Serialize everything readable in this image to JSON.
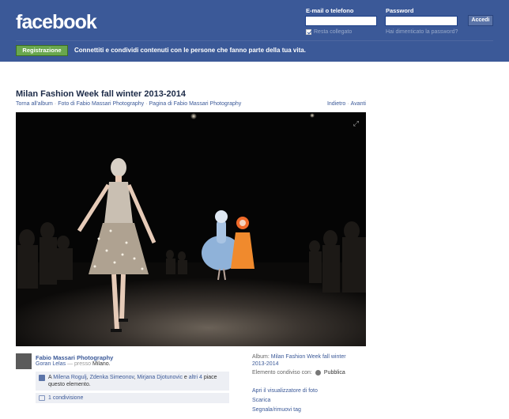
{
  "header": {
    "logo": "facebook",
    "email_label": "E-mail o telefono",
    "password_label": "Password",
    "login_button": "Accedi",
    "keep_logged_in": "Resta collegato",
    "forgot_password": "Hai dimenticato la password?",
    "register_button": "Registrazione",
    "tagline": "Connettiti e condividi contenuti con le persone che fanno parte della tua vita."
  },
  "album": {
    "title": "Milan Fashion Week fall winter 2013-2014",
    "crumbs": [
      "Torna all'album",
      "Foto di Fabio Massari Photography",
      "Pagina di Fabio Massari Photography"
    ],
    "prev": "Indietro",
    "next": "Avanti"
  },
  "post": {
    "owner": "Fabio Massari Photography",
    "tagged": "Goran Lelas",
    "with_sep": "— presso",
    "location": "Milano.",
    "likes_text_pre": "A",
    "likers": [
      "Milena Rogulj",
      "Zdenka Simeonov",
      "Mirjana Djotunovic"
    ],
    "likes_and": "e",
    "likes_others": "altri 4",
    "likes_suffix_1": "piace",
    "likes_suffix_2": "questo elemento.",
    "shares": "1 condivisione"
  },
  "sidebar": {
    "album_label": "Album:",
    "album_name_line1": "Milan Fashion Week fall winter",
    "album_name_line2": "2013-2014",
    "shared_label": "Elemento condiviso con:",
    "audience": "Pubblica",
    "actions": [
      "Apri il visualizzatore di foto",
      "Scarica",
      "Segnala/rimuovi tag"
    ]
  },
  "icons": [
    "checkbox-icon",
    "expand-icon",
    "like-icon",
    "share-icon",
    "globe-icon"
  ]
}
